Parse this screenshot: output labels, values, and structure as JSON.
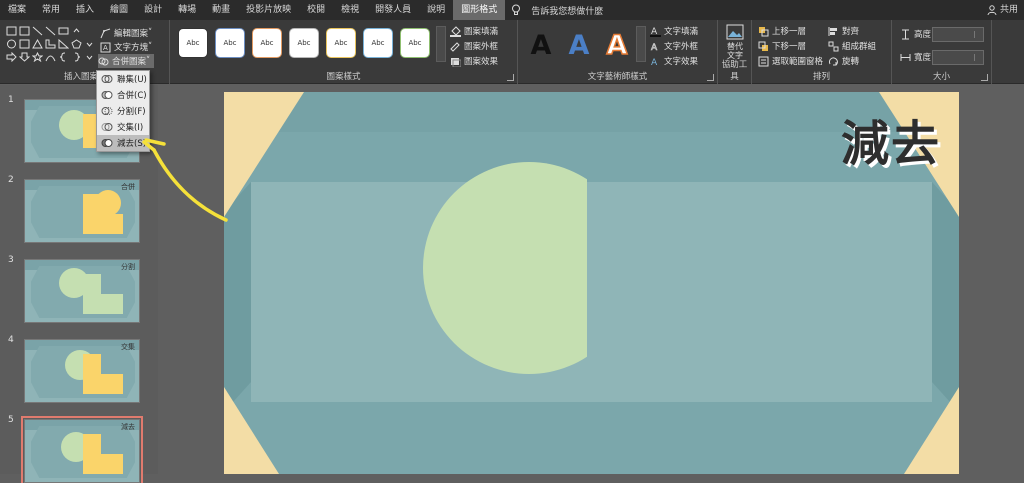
{
  "tabs": [
    "檔案",
    "常用",
    "插入",
    "繪圖",
    "設計",
    "轉場",
    "動畫",
    "投影片放映",
    "校閱",
    "檢視",
    "開發人員",
    "說明",
    "圖形格式"
  ],
  "active_tab": "圖形格式",
  "tell_me": "告訴我您想做什麼",
  "share": "共用",
  "ribbon": {
    "insert_shapes": {
      "label": "插入圖案",
      "edit_shape": "編輯圖案",
      "text_box": "文字方塊",
      "merge_shapes": "合併圖案"
    },
    "shape_styles": {
      "label": "圖案樣式",
      "style_text": "Abc",
      "fill": "圖案填滿",
      "outline": "圖案外框",
      "effects": "圖案效果"
    },
    "wordart_styles": {
      "label": "文字藝術師樣式",
      "letter": "A",
      "text_fill": "文字填滿",
      "text_outline": "文字外框",
      "text_effects": "文字效果"
    },
    "accessibility": {
      "label": "協助工具",
      "alt_text": "替代文字"
    },
    "arrange": {
      "label": "排列",
      "bring_forward": "上移一層",
      "send_backward": "下移一層",
      "selection_pane": "選取範圍窗格",
      "align": "對齊",
      "group": "組成群組",
      "rotate": "旋轉"
    },
    "size": {
      "label": "大小",
      "height": "高度:",
      "width": "寬度:"
    }
  },
  "merge_menu": {
    "items": [
      "聯集(U)",
      "合併(C)",
      "分割(F)",
      "交集(I)",
      "減去(S)"
    ],
    "hovered": "減去(S)"
  },
  "slides": [
    {
      "num": "1",
      "label": ""
    },
    {
      "num": "2",
      "label": "合併"
    },
    {
      "num": "3",
      "label": "分割"
    },
    {
      "num": "4",
      "label": "交集"
    },
    {
      "num": "5",
      "label": "減去"
    }
  ],
  "current_slide_title": "減去",
  "colors": {
    "slide_teal": "#8fb5b7",
    "slide_dark_teal": "#7ba7ab",
    "shape_green": "#c5dfb1",
    "shape_yellow": "#fad46a",
    "corner_cream": "#f3dda6",
    "annotation_arrow": "#f5e13a",
    "selected_outline": "#e07b6e"
  }
}
